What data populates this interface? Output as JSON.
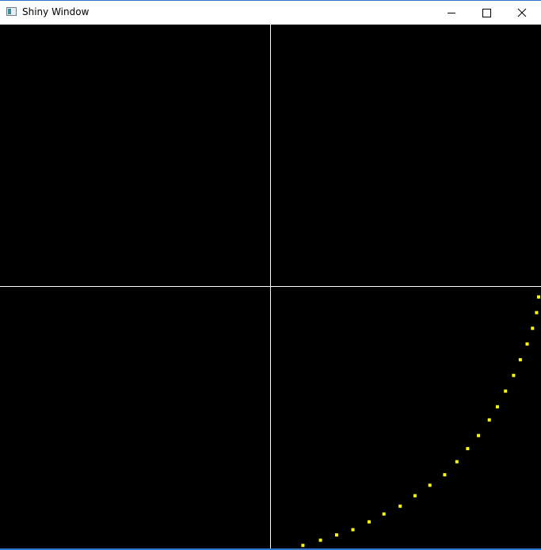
{
  "window": {
    "title": "Shiny Window",
    "icons": {
      "app": "app-window-icon",
      "minimize": "minimize-icon",
      "maximize": "maximize-icon",
      "close": "close-icon"
    }
  },
  "colors": {
    "canvas_background": "#000000",
    "axis_lines": "#ffffff",
    "points": "#ffff00",
    "frame_accent": "#2b78c9"
  },
  "plot": {
    "x_range": [
      -1,
      1
    ],
    "y_range": [
      -1,
      1
    ],
    "points": [
      {
        "x": 0.12,
        "y": -0.99
      },
      {
        "x": 0.185,
        "y": -0.97
      },
      {
        "x": 0.245,
        "y": -0.95
      },
      {
        "x": 0.305,
        "y": -0.93
      },
      {
        "x": 0.365,
        "y": -0.9
      },
      {
        "x": 0.42,
        "y": -0.87
      },
      {
        "x": 0.48,
        "y": -0.84
      },
      {
        "x": 0.535,
        "y": -0.8
      },
      {
        "x": 0.59,
        "y": -0.76
      },
      {
        "x": 0.645,
        "y": -0.72
      },
      {
        "x": 0.69,
        "y": -0.67
      },
      {
        "x": 0.73,
        "y": -0.62
      },
      {
        "x": 0.77,
        "y": -0.57
      },
      {
        "x": 0.81,
        "y": -0.51
      },
      {
        "x": 0.84,
        "y": -0.46
      },
      {
        "x": 0.87,
        "y": -0.4
      },
      {
        "x": 0.9,
        "y": -0.34
      },
      {
        "x": 0.925,
        "y": -0.28
      },
      {
        "x": 0.95,
        "y": -0.22
      },
      {
        "x": 0.97,
        "y": -0.16
      },
      {
        "x": 0.985,
        "y": -0.1
      },
      {
        "x": 0.998,
        "y": -0.04
      }
    ]
  }
}
